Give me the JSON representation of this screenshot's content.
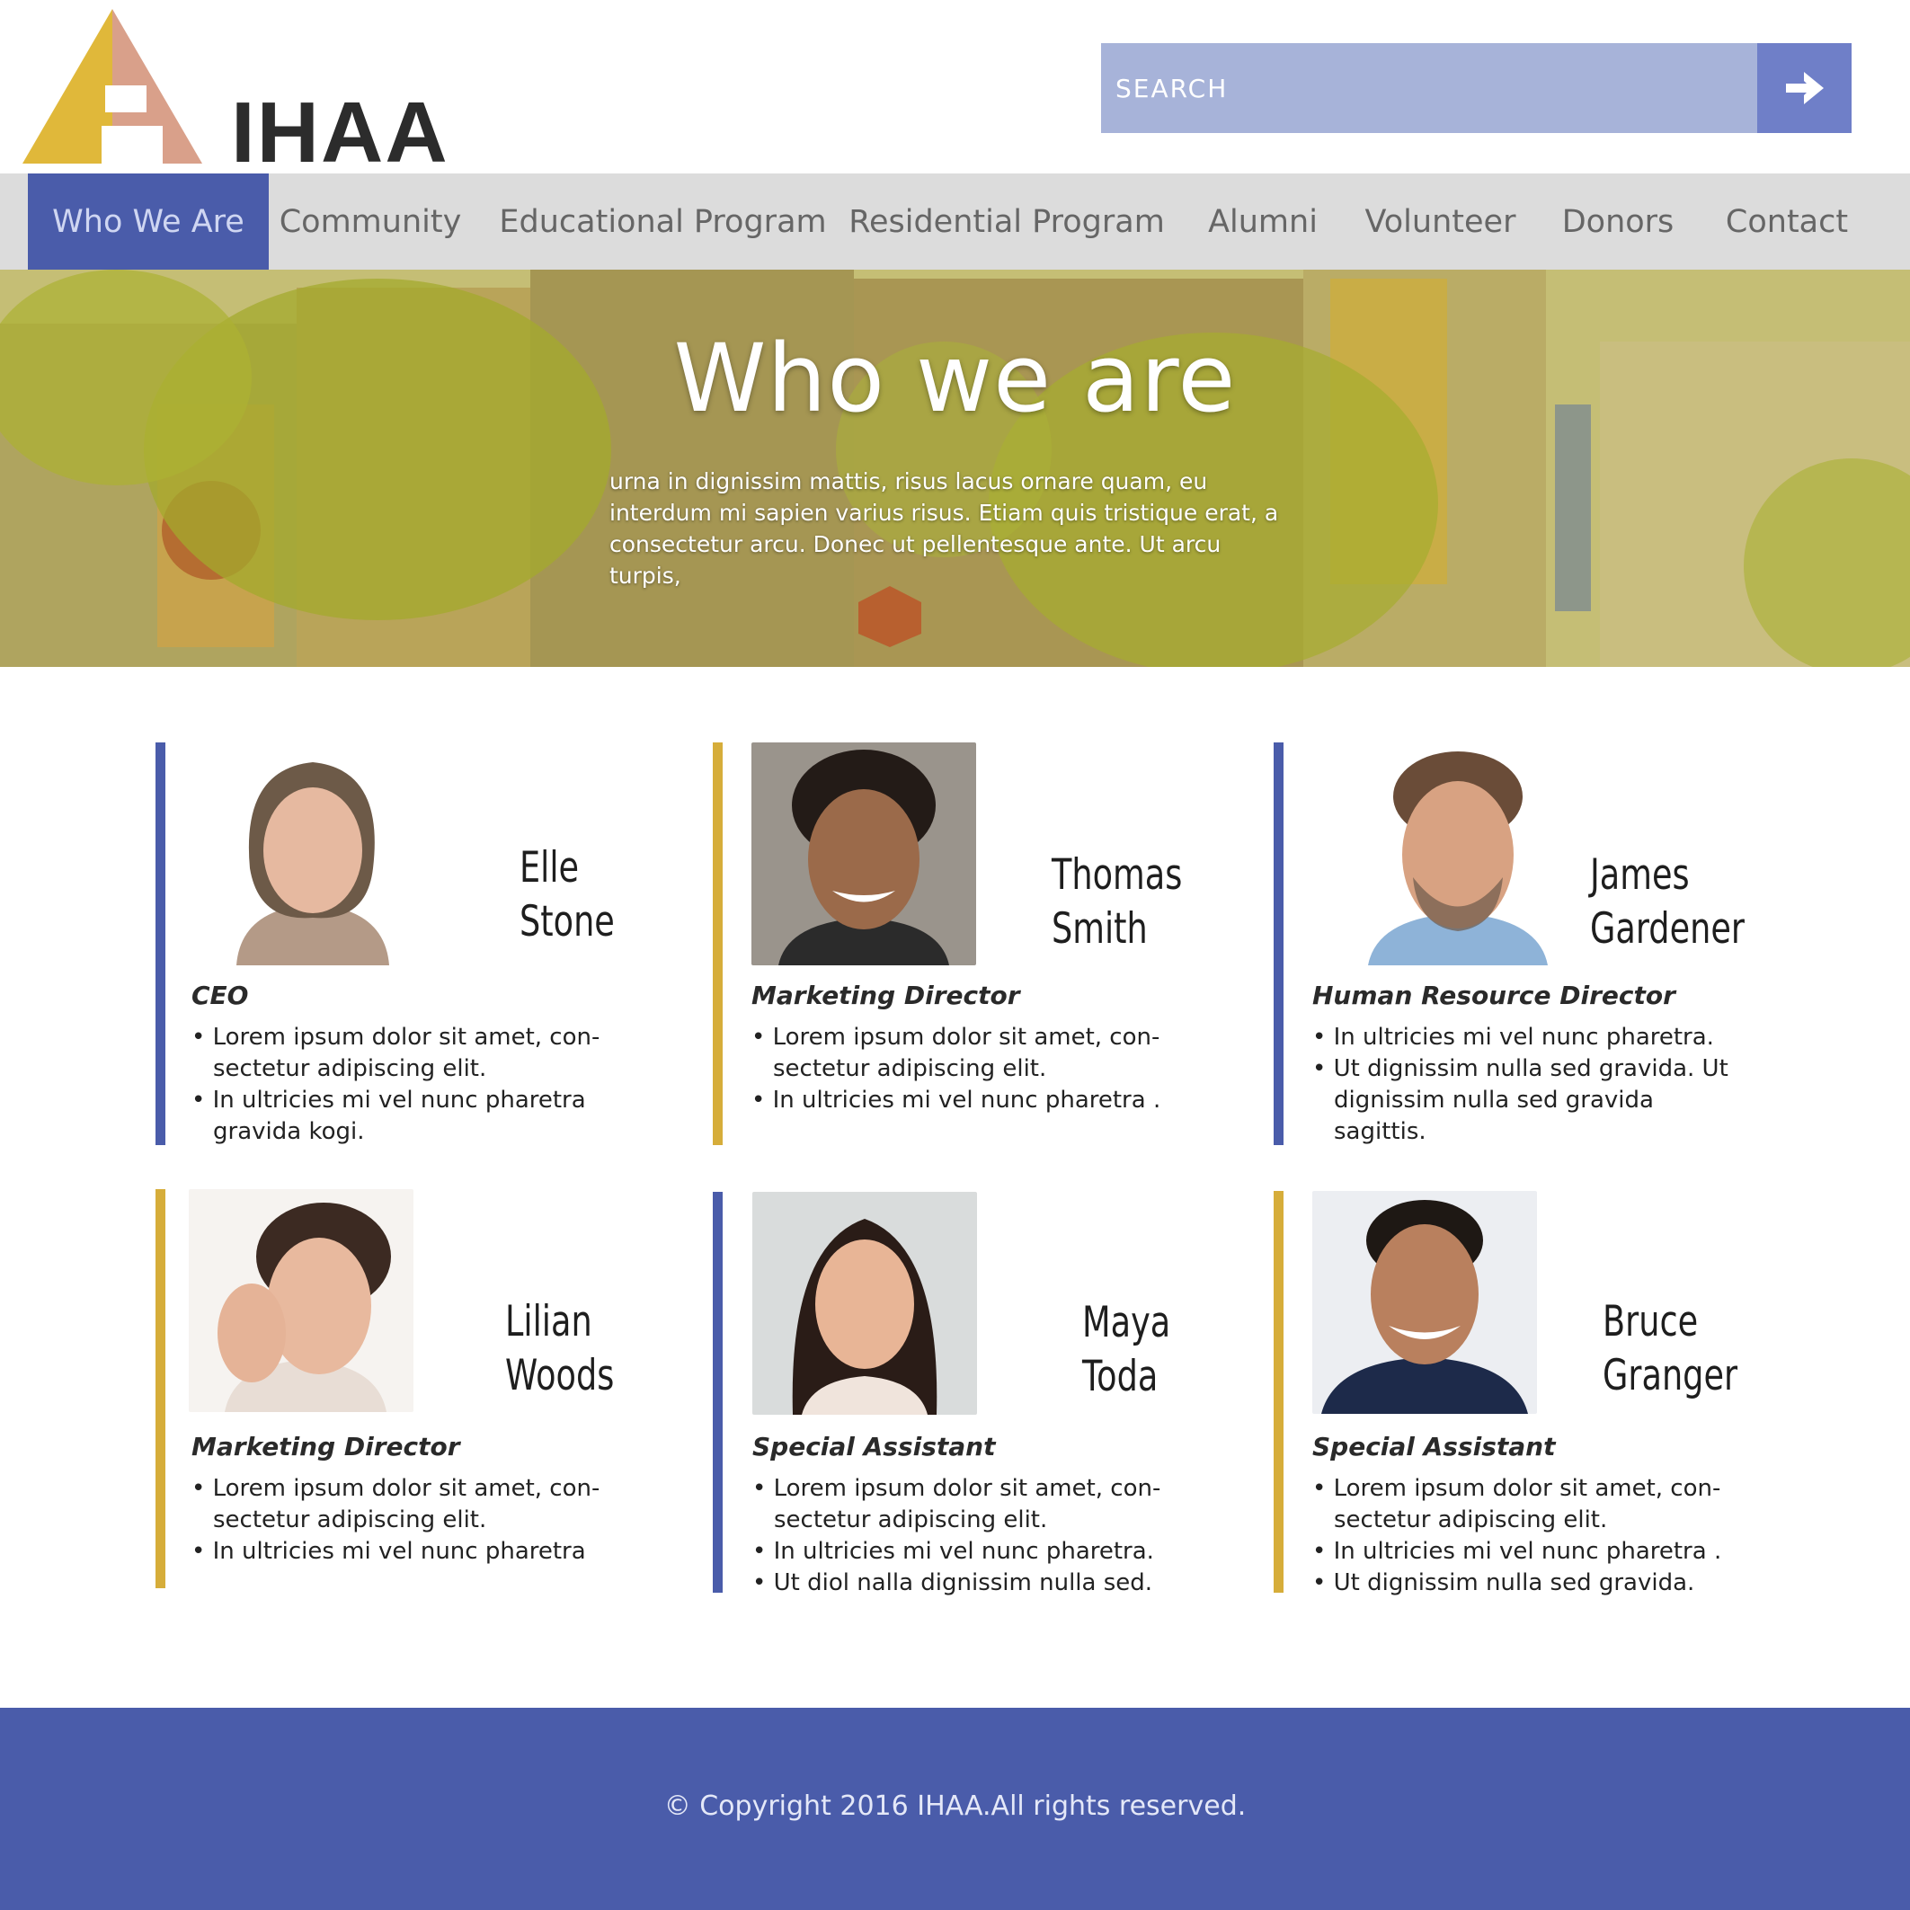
{
  "header": {
    "logo_text": "IHAA",
    "search_placeholder": "SEARCH"
  },
  "nav": {
    "items": [
      {
        "label": "Who We Are",
        "active": true
      },
      {
        "label": "Community"
      },
      {
        "label": "Educational Program"
      },
      {
        "label": "Residential Program"
      },
      {
        "label": "Alumni"
      },
      {
        "label": "Volunteer"
      },
      {
        "label": "Donors"
      },
      {
        "label": "Contact"
      }
    ]
  },
  "hero": {
    "title": "Who we are",
    "text": "urna in dignissim mattis, risus lacus ornare quam, eu interdum mi sapien varius risus. Etiam quis tristique erat, a consectetur arcu. Donec ut pellentesque ante. Ut arcu turpis,"
  },
  "people": [
    {
      "first": "Elle",
      "last": "Stone",
      "role": "CEO",
      "accent": "blue",
      "bullets": [
        "Lorem ipsum dolor sit amet, con-sectetur adipiscing elit.",
        "In ultricies mi vel nunc pharetra gravida kogi."
      ]
    },
    {
      "first": "Thomas",
      "last": "Smith",
      "role": "Marketing Director",
      "accent": "gold",
      "bullets": [
        "Lorem ipsum dolor sit amet, con-sectetur adipiscing elit.",
        "In ultricies mi vel nunc pharetra ."
      ]
    },
    {
      "first": "James",
      "last": "Gardener",
      "role": "Human Resource Director",
      "accent": "blue",
      "bullets": [
        "In ultricies mi vel nunc pharetra.",
        "Ut dignissim nulla sed gravida. Ut dignissim nulla sed gravida sagittis."
      ]
    },
    {
      "first": "Lilian",
      "last": "Woods",
      "role": "Marketing Director",
      "accent": "gold",
      "bullets": [
        "Lorem ipsum dolor sit amet, con-sectetur adipiscing elit.",
        "In ultricies mi vel nunc pharetra"
      ]
    },
    {
      "first": "Maya",
      "last": "Toda",
      "role": "Special Assistant",
      "accent": "blue",
      "bullets": [
        "Lorem ipsum dolor sit amet, con-sectetur adipiscing elit.",
        "In ultricies mi vel nunc pharetra.",
        "Ut diol nalla dignissim nulla sed."
      ]
    },
    {
      "first": "Bruce",
      "last": "Granger",
      "role": "Special Assistant",
      "accent": "gold",
      "bullets": [
        "Lorem ipsum dolor sit amet, con-sectetur adipiscing elit.",
        "In ultricies mi vel nunc pharetra .",
        "Ut dignissim nulla sed gravida."
      ]
    }
  ],
  "footer": {
    "copyright": "© Copyright 2016  IHAA.All rights reserved."
  },
  "colors": {
    "brand_blue": "#4a5caa",
    "brand_gold": "#d6ad3a",
    "logo_pink": "#d9a08a",
    "search_field": "#a7b3d9",
    "nav_bg": "#dcdcdc"
  },
  "icons": {
    "search_button": "arrow-right-icon",
    "logo": "triangle-house-logo"
  }
}
